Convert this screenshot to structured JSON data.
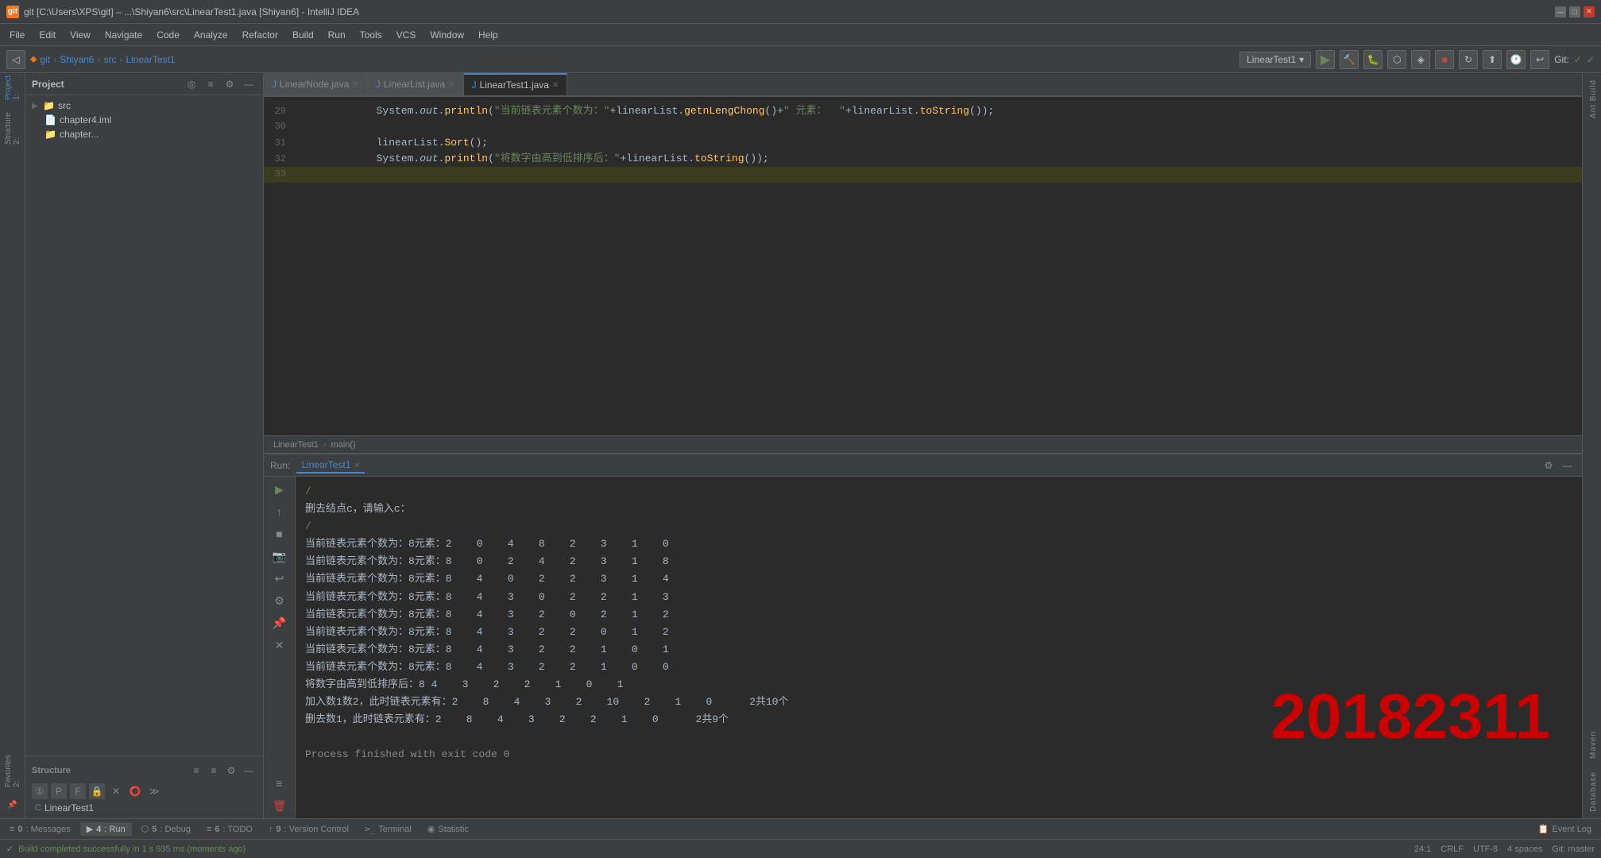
{
  "titleBar": {
    "icon": "git",
    "title": "git [C:\\Users\\XPS\\git] – ...\\Shiyan6\\src\\LinearTest1.java [Shiyan6] - IntelliJ IDEA",
    "minBtn": "—",
    "maxBtn": "□",
    "closeBtn": "✕"
  },
  "menuBar": {
    "items": [
      "File",
      "Edit",
      "View",
      "Navigate",
      "Code",
      "Analyze",
      "Refactor",
      "Build",
      "Run",
      "Tools",
      "VCS",
      "Window",
      "Help"
    ]
  },
  "navBar": {
    "gitIcon": "⬥",
    "breadcrumb": [
      "git",
      "Shiyan6",
      "src",
      "LinearTest1"
    ],
    "runDropdown": "LinearTest1",
    "gitLabel": "Git:",
    "gitStatus1": "✓",
    "gitStatus2": "✓"
  },
  "projectPanel": {
    "title": "Project",
    "tree": [
      {
        "level": 1,
        "type": "folder",
        "name": "src",
        "arrow": "▶"
      },
      {
        "level": 2,
        "type": "iml",
        "name": "chapter4.iml"
      },
      {
        "level": 2,
        "type": "folder",
        "name": "chapter..."
      }
    ]
  },
  "structurePanel": {
    "title": "Structure",
    "activeClass": "LinearTest1"
  },
  "tabs": [
    {
      "label": "LinearNode.java",
      "active": false,
      "closable": true
    },
    {
      "label": "LinearList.java",
      "active": false,
      "closable": true
    },
    {
      "label": "LinearTest1.java",
      "active": true,
      "closable": true
    }
  ],
  "codeLines": [
    {
      "num": "29",
      "content": "            System.out.println(\"当前链表元素个数为：\"+linearList.getnLengChong()+\" 元素：  \"+linearList.toString());",
      "highlighted": false
    },
    {
      "num": "30",
      "content": "",
      "highlighted": false
    },
    {
      "num": "31",
      "content": "            linearList.Sort();",
      "highlighted": false
    },
    {
      "num": "32",
      "content": "            System.out.println(\"将数字由高到低排序后：\"+linearList.toString());",
      "highlighted": false
    },
    {
      "num": "33",
      "content": "",
      "highlighted": true
    }
  ],
  "breadcrumb": {
    "class": "LinearTest1",
    "method": "main()"
  },
  "runPanel": {
    "label": "Run:",
    "tabLabel": "LinearTest1",
    "outputLines": [
      {
        "text": "/",
        "type": "cmd"
      },
      {
        "text": "删去结点c，请输入c：",
        "type": "normal"
      },
      {
        "text": "/",
        "type": "cmd"
      },
      {
        "text": "当前链表元素个数为：8元素：2  0  4  8  2  3  1  0",
        "type": "normal"
      },
      {
        "text": "当前链表元素个数为：8元素：8  0  2  4  2  3  1  8",
        "type": "normal"
      },
      {
        "text": "当前链表元素个数为：8元素：8  4  0  2  2  3  1  4",
        "type": "normal"
      },
      {
        "text": "当前链表元素个数为：8元素：8  4  3  0  2  2  1  3",
        "type": "normal"
      },
      {
        "text": "当前链表元素个数为：8元素：8  4  3  2  0  2  1  2",
        "type": "normal"
      },
      {
        "text": "当前链表元素个数为：8元素：8  4  3  2  2  0  1  2",
        "type": "normal"
      },
      {
        "text": "当前链表元素个数为：8元素：8  4  3  2  2  1  0  1",
        "type": "normal"
      },
      {
        "text": "当前链表元素个数为：8元素：8  4  3  2  2  1  0  0",
        "type": "normal"
      },
      {
        "text": "将数字由高到低排序后：8 4  3  2  2  1  0  1",
        "type": "normal"
      },
      {
        "text": "加入数1数2，此时链表元素有：2  8  4  3  2  10  2  1  0   2共10个",
        "type": "normal"
      },
      {
        "text": "删去数1，此时链表元素有：2  8  4  3  2  2  1  0   2共9个",
        "type": "normal"
      },
      {
        "text": "",
        "type": "normal"
      },
      {
        "text": "Process finished with exit code 0",
        "type": "gray"
      }
    ],
    "bigNumber": "20182311"
  },
  "rightSidebars": {
    "antBuild": "Ant Build",
    "maven": "Maven",
    "database": "Database"
  },
  "leftSidebars": {
    "project": "1: Project",
    "structure": "2: Structure",
    "favorites": "2: Favorites"
  },
  "bottomTabs": [
    {
      "num": "0",
      "label": "Messages",
      "icon": "≡"
    },
    {
      "num": "4",
      "label": "Run",
      "icon": "▶",
      "active": true
    },
    {
      "num": "5",
      "label": "Debug",
      "icon": "⬡"
    },
    {
      "num": "6",
      "label": "TODO",
      "icon": "≡"
    },
    {
      "num": "9",
      "label": "Version Control",
      "icon": "↑"
    },
    {
      "num": "",
      "label": "Terminal",
      "icon": ">_"
    },
    {
      "num": "",
      "label": "Statistic",
      "icon": "◉"
    }
  ],
  "statusBar": {
    "buildMsg": "Build completed successfully in 1 s 935 ms (moments ago)",
    "position": "24:1",
    "lineEnding": "CRLF",
    "encoding": "UTF-8",
    "indent": "4 spaces",
    "vcs": "Git: master",
    "eventLog": "Event Log"
  }
}
